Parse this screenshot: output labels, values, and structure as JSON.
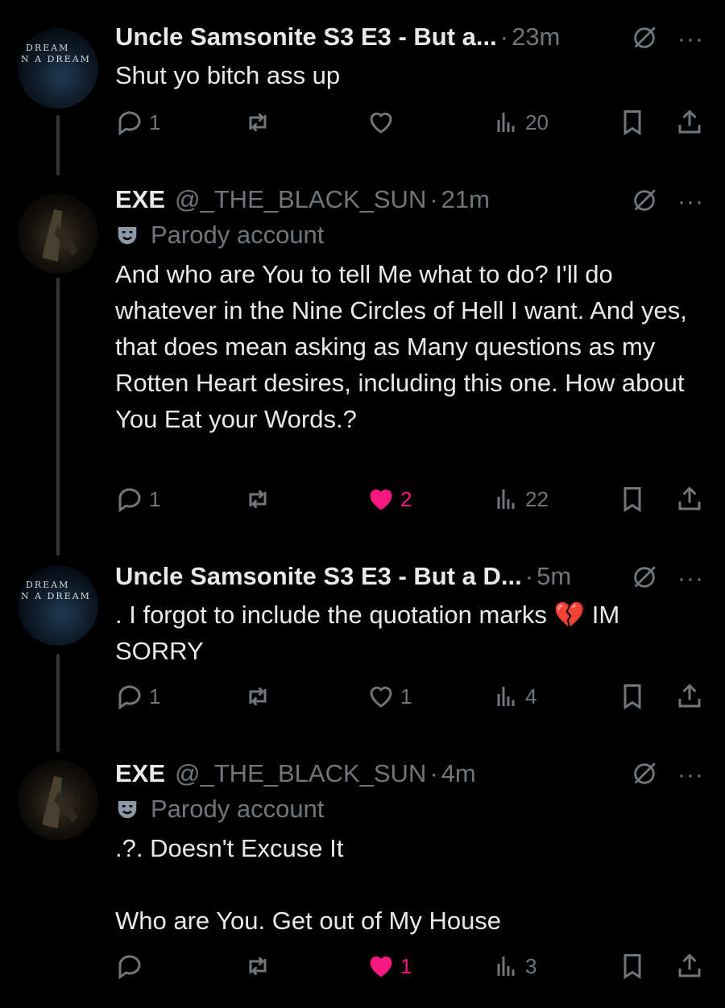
{
  "tweets": [
    {
      "author": "Uncle Samsonite S3 E3 - But a...",
      "handle": "",
      "dot": "·",
      "time": "23m",
      "parody_label": "",
      "text": "Shut yo bitch ass up",
      "replies": "1",
      "reposts": "",
      "likes": "",
      "liked": false,
      "views": "20",
      "avatar_text": [
        "DREAM",
        "N A DREAM"
      ]
    },
    {
      "author": "EXE",
      "handle": "@_THE_BLACK_SUN",
      "dot": "·",
      "time": "21m",
      "parody_label": "Parody account",
      "text": "And who are You to tell Me what to do? I'll do whatever in the Nine Circles of Hell I want. And yes, that does mean asking as Many questions as my Rotten Heart desires, including this one. How about You Eat your Words.?",
      "replies": "1",
      "reposts": "",
      "likes": "2",
      "liked": true,
      "views": "22"
    },
    {
      "author": "Uncle Samsonite S3 E3 - But a D...",
      "handle": "",
      "dot": "·",
      "time": "5m",
      "parody_label": "",
      "text": ". I forgot to include the quotation marks 💔 IM SORRY",
      "replies": "1",
      "reposts": "",
      "likes": "1",
      "liked": false,
      "views": "4",
      "avatar_text": [
        "DREAM",
        "N A DREAM"
      ]
    },
    {
      "author": "EXE",
      "handle": "@_THE_BLACK_SUN",
      "dot": "·",
      "time": "4m",
      "parody_label": "Parody account",
      "text": ".?. Doesn't Excuse It\n\nWho are You. Get out of My House",
      "replies": "",
      "reposts": "",
      "likes": "1",
      "liked": true,
      "views": "3"
    }
  ],
  "icons": {
    "reply": "reply-icon",
    "repost": "repost-icon",
    "like": "heart-icon",
    "views": "views-icon",
    "bookmark": "bookmark-icon",
    "share": "share-icon",
    "grok": "grok-icon",
    "more": "more-icon",
    "parody": "parody-mask-icon"
  },
  "more_label": "···",
  "colors": {
    "background": "#000000",
    "text": "#e7e9ea",
    "muted": "#71767b",
    "like": "#f91880"
  }
}
